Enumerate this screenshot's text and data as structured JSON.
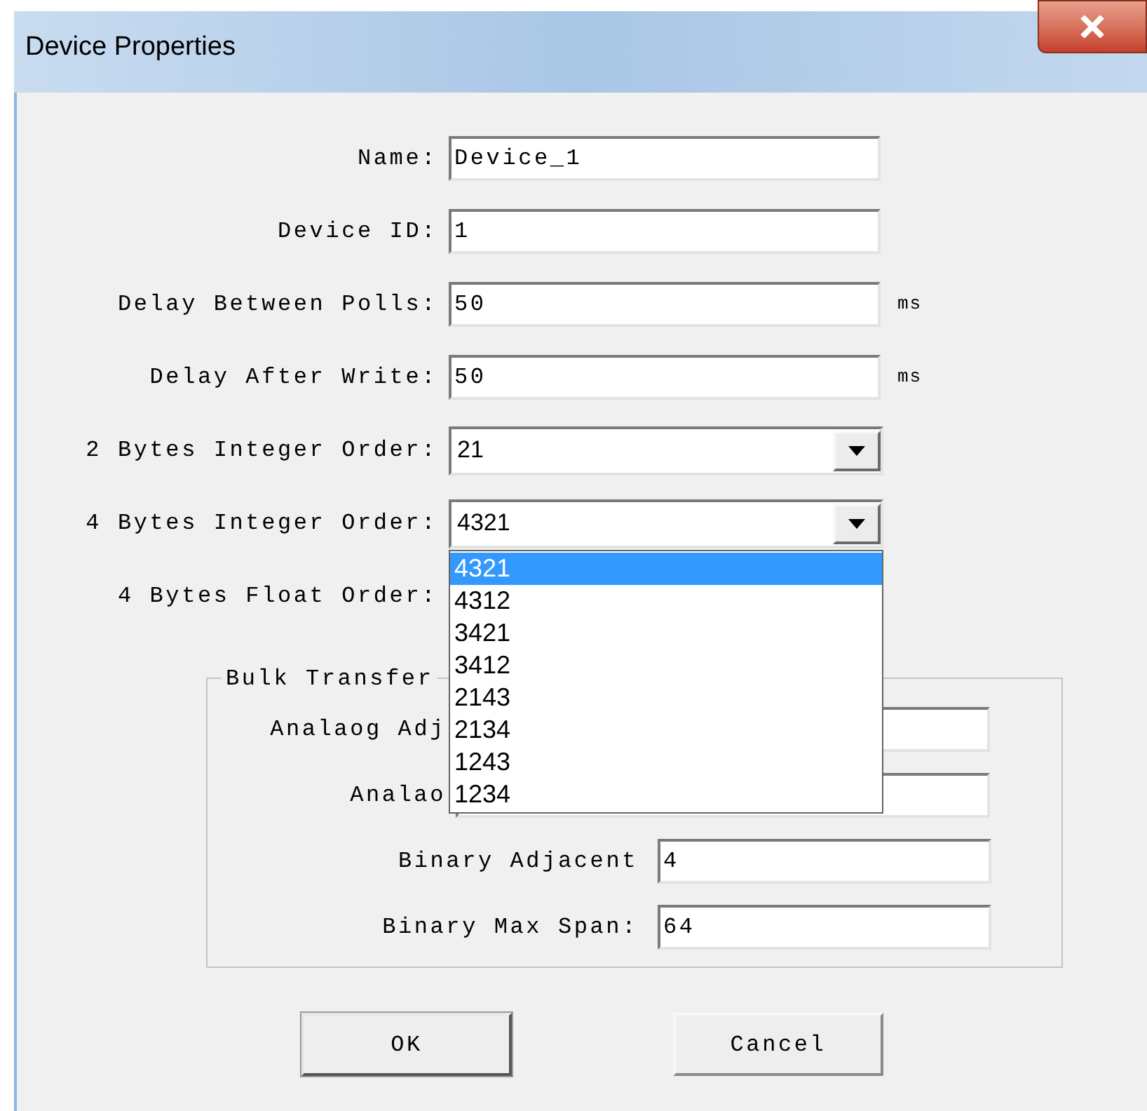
{
  "window": {
    "title": "Device Properties"
  },
  "fields": [
    {
      "kind": "text",
      "label": "Name:",
      "value": "Device_1"
    },
    {
      "kind": "text",
      "label": "Device ID:",
      "value": "1"
    },
    {
      "kind": "text",
      "label": "Delay Between Polls:",
      "value": "50",
      "unit": "ms"
    },
    {
      "kind": "text",
      "label": "Delay After Write:",
      "value": "50",
      "unit": "ms"
    },
    {
      "kind": "combo",
      "label": "2 Bytes Integer Order:",
      "value": "21"
    },
    {
      "kind": "combo",
      "label": "4 Bytes Integer Order:",
      "value": "4321",
      "options": [
        {
          "label": "4321",
          "selected": true
        },
        {
          "label": "4312",
          "selected": false
        },
        {
          "label": "3421",
          "selected": false
        },
        {
          "label": "3412",
          "selected": false
        },
        {
          "label": "2143",
          "selected": false
        },
        {
          "label": "2134",
          "selected": false
        },
        {
          "label": "1243",
          "selected": false
        },
        {
          "label": "1234",
          "selected": false
        }
      ]
    },
    {
      "kind": "label",
      "label": "4 Bytes Float Order:"
    }
  ],
  "group": {
    "title": "Bulk Transfer",
    "fields": [
      {
        "kind": "partial",
        "label": "Analaog Adj"
      },
      {
        "kind": "partial",
        "label": "Analao"
      },
      {
        "kind": "field",
        "label": "Binary Adjacent",
        "value": "4"
      },
      {
        "kind": "field",
        "label": "Binary Max Span:",
        "value": "64"
      }
    ]
  },
  "buttons": [
    {
      "label": "OK",
      "default": true
    },
    {
      "label": "Cancel",
      "default": false
    }
  ]
}
